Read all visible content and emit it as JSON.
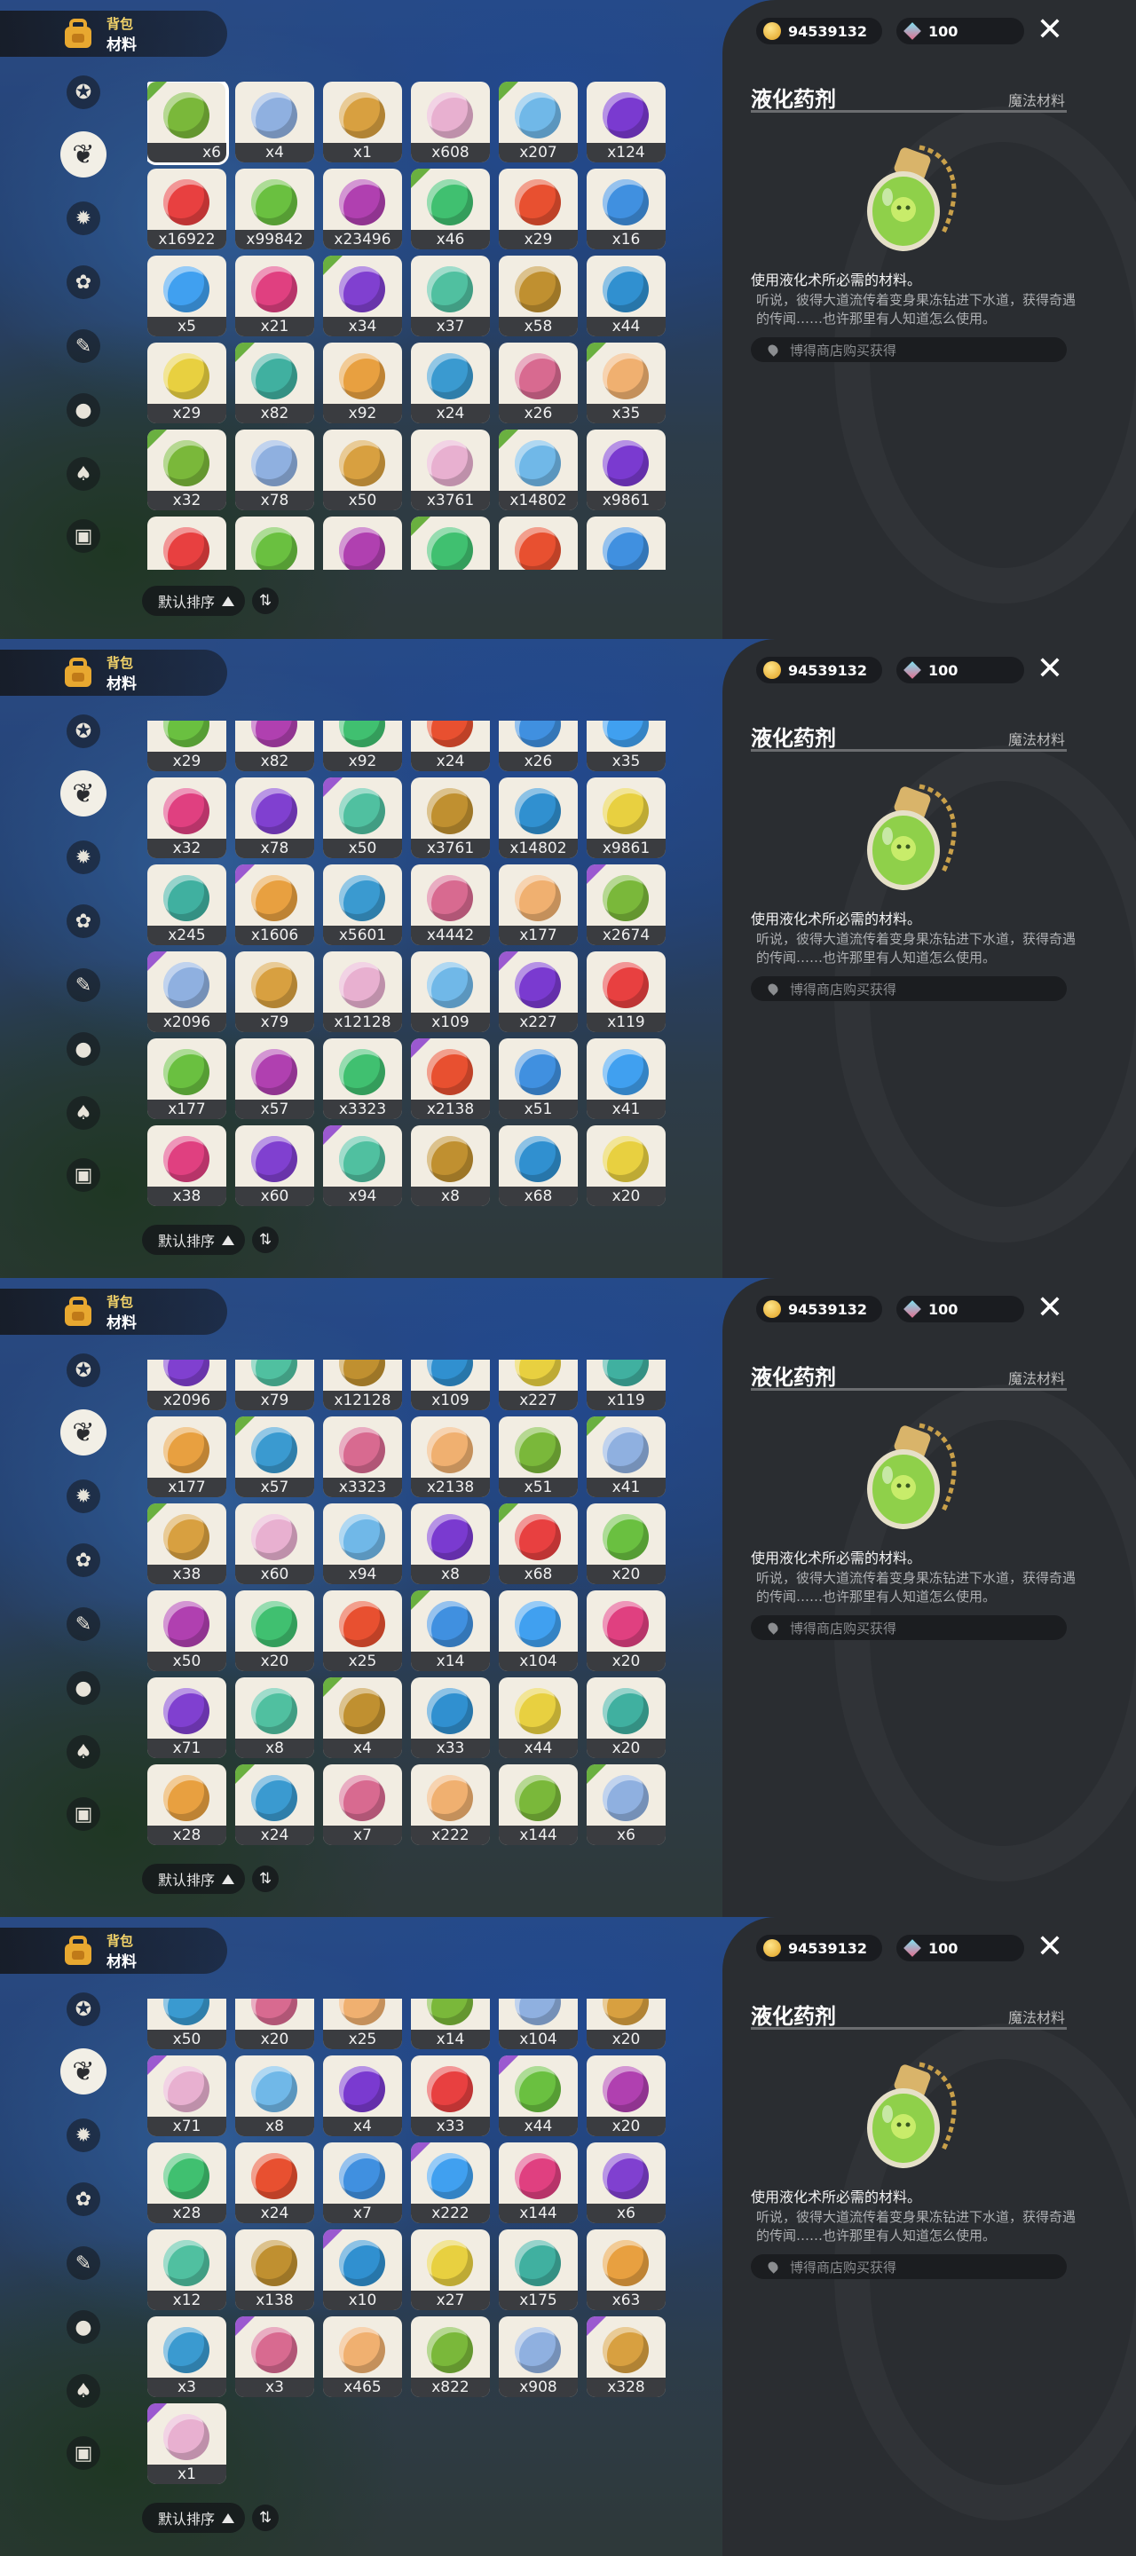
{
  "header": {
    "title_top": "背包",
    "title_bottom": "材料"
  },
  "sidebar": {
    "icons": [
      "star-badge-icon",
      "leaf-icon",
      "sun-gear-icon",
      "flower-icon",
      "scroll-icon",
      "ball-icon",
      "acorn-icon",
      "chest-icon"
    ],
    "active_index": 1
  },
  "currency": {
    "coins": "94539132",
    "gems": "100"
  },
  "detail": {
    "name": "液化药剂",
    "category": "魔法材料",
    "summary": "使用液化术所必需的材料。",
    "lore": "听说，彼得大道流传着变身果冻钻进下水道，获得奇遇的传闻……也许那里有人知道怎么使用。",
    "source": "博得商店购买获得"
  },
  "sort": {
    "label": "默认排序",
    "toggle_glyph": "⇅"
  },
  "frames": [
    {
      "rows": [
        [
          "x6",
          "x4",
          "x1",
          "x608",
          "x207",
          "x124"
        ],
        [
          "x16922",
          "x99842",
          "x23496",
          "x46",
          "x29",
          "x16"
        ],
        [
          "x5",
          "x21",
          "x34",
          "x37",
          "x58",
          "x44"
        ],
        [
          "x29",
          "x82",
          "x92",
          "x24",
          "x26",
          "x35"
        ],
        [
          "x32",
          "x78",
          "x50",
          "x3761",
          "x14802",
          "x9861"
        ],
        [
          "",
          "",
          "",
          "",
          "",
          ""
        ]
      ]
    },
    {
      "rows": [
        [
          "x29",
          "x82",
          "x92",
          "x24",
          "x26",
          "x35"
        ],
        [
          "x32",
          "x78",
          "x50",
          "x3761",
          "x14802",
          "x9861"
        ],
        [
          "x245",
          "x1606",
          "x5601",
          "x4442",
          "x177",
          "x2674"
        ],
        [
          "x2096",
          "x79",
          "x12128",
          "x109",
          "x227",
          "x119"
        ],
        [
          "x177",
          "x57",
          "x3323",
          "x2138",
          "x51",
          "x41"
        ],
        [
          "x38",
          "x60",
          "x94",
          "x8",
          "x68",
          "x20"
        ]
      ]
    },
    {
      "rows": [
        [
          "x2096",
          "x79",
          "x12128",
          "x109",
          "x227",
          "x119"
        ],
        [
          "x177",
          "x57",
          "x3323",
          "x2138",
          "x51",
          "x41"
        ],
        [
          "x38",
          "x60",
          "x94",
          "x8",
          "x68",
          "x20"
        ],
        [
          "x50",
          "x20",
          "x25",
          "x14",
          "x104",
          "x20"
        ],
        [
          "x71",
          "x8",
          "x4",
          "x33",
          "x44",
          "x20"
        ],
        [
          "x28",
          "x24",
          "x7",
          "x222",
          "x144",
          "x6"
        ]
      ]
    },
    {
      "rows": [
        [
          "x50",
          "x20",
          "x25",
          "x14",
          "x104",
          "x20"
        ],
        [
          "x71",
          "x8",
          "x4",
          "x33",
          "x44",
          "x20"
        ],
        [
          "x28",
          "x24",
          "x7",
          "x222",
          "x144",
          "x6"
        ],
        [
          "x12",
          "x138",
          "x10",
          "x27",
          "x175",
          "x63"
        ],
        [
          "x3",
          "x3",
          "x465",
          "x822",
          "x908",
          "x328"
        ],
        [
          "x1"
        ]
      ]
    }
  ],
  "colors": {
    "palette": [
      "#7ab83a",
      "#8fb0e0",
      "#d8a040",
      "#e8b0d0",
      "#70b8e8",
      "#7a3ad0",
      "#e84040",
      "#6ac040",
      "#b040b0",
      "#40c070",
      "#e85030",
      "#4090e0",
      "#40a0f0",
      "#e04080",
      "#8040d0",
      "#50c0a0",
      "#c09030",
      "#3090d0",
      "#e8d040",
      "#40b0a0",
      "#e8a040",
      "#3a9ad0",
      "#d86a90",
      "#f0b070"
    ]
  }
}
